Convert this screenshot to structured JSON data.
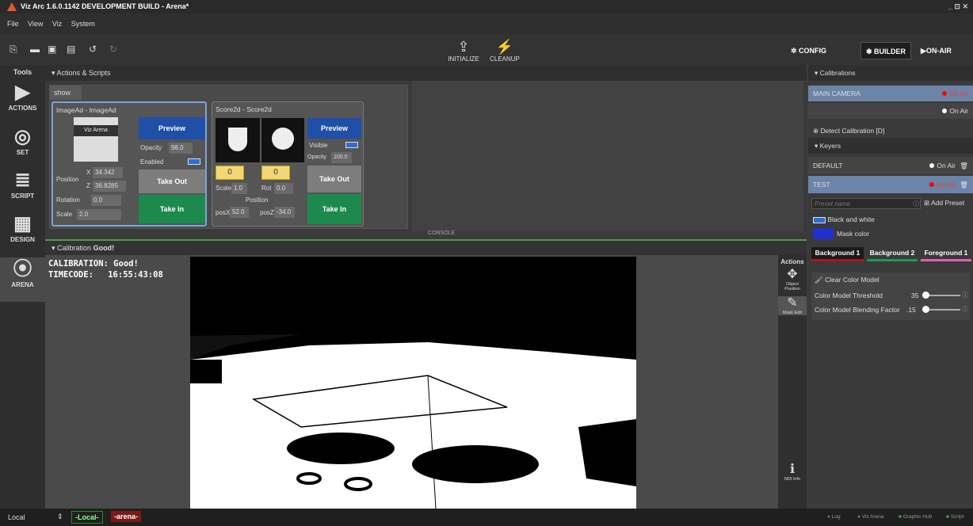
{
  "app": {
    "title": "Viz Arc 1.6.0.1142 DEVELOPMENT BUILD - Arena*",
    "window_controls": "_ ⊡ ✕"
  },
  "menu": [
    "File",
    "View",
    "Viz",
    "System"
  ],
  "toolbar": {
    "initialize": "INITIALIZE",
    "cleanup": "CLEANUP",
    "config": "CONFIG",
    "builder": "BUILDER",
    "on_air": "ON-AIR"
  },
  "tools": {
    "header": "Tools",
    "items": [
      "ACTIONS",
      "SET",
      "SCRIPT",
      "DESIGN",
      "ARENA"
    ]
  },
  "actions_panel": {
    "title": "Actions & Scripts",
    "tab": "show",
    "console": "CONSOLE"
  },
  "imagead": {
    "title": "ImageAd - ImageAd",
    "thumb_text": "Viz Arena",
    "preview": "Preview",
    "opacity_label": "Opacity",
    "opacity": "98.0",
    "enabled_label": "Enabled",
    "position_label": "Position",
    "x_label": "X",
    "x": "34.342",
    "z_label": "Z",
    "z": "36.8285",
    "rotation_label": "Rotation",
    "rotation": "0.0",
    "scale_label": "Scale",
    "scale": "2.0",
    "take_out": "Take Out",
    "take_in": "Take In"
  },
  "score2d": {
    "title": "Score2d - Score2d",
    "preview": "Preview",
    "visible_label": "Visible",
    "opacity_label": "Opacity",
    "opacity": "100.0",
    "score_home": "0",
    "score_away": "0",
    "scale_label": "Scale",
    "scale": "1.0",
    "rot_label": "Rot",
    "rot": "0.0",
    "position_label": "Position",
    "posx_label": "posX",
    "posx": "52.0",
    "posz_label": "posZ",
    "posz": "-34.0",
    "take_out": "Take Out",
    "take_in": "Take In"
  },
  "calibration_bar": {
    "label": "Calibration",
    "status": "Good!"
  },
  "overlay": {
    "calibration": "CALIBRATION: Good!",
    "timecode_label": "TIMECODE:",
    "timecode": "16:55:43:08"
  },
  "viewport_actions": {
    "header": "Actions",
    "object_position": "Object Position",
    "mask_edit": "Mask Edit",
    "ndi_info": "NDI Info"
  },
  "right_panel": {
    "calibrations_header": "Calibrations",
    "cameras": [
      {
        "name": "MAIN CAMERA",
        "status": "On Air"
      },
      {
        "name": "",
        "status": "On Air"
      }
    ],
    "detect": "Detect Calibration [D]",
    "keyers_header": "Keyers",
    "keyers": [
      {
        "name": "DEFAULT",
        "status": "On Air"
      },
      {
        "name": "TEST",
        "status": "On Air"
      }
    ],
    "preset_placeholder": "Preset name",
    "add_preset": "Add Preset",
    "black_and_white": "Black and white",
    "mask_color": "Mask color",
    "tabs": [
      "Background 1",
      "Background 2",
      "Foreground 1"
    ],
    "clear_model": "Clear Color Model",
    "threshold_label": "Color Model Threshold",
    "threshold": "35",
    "blending_label": "Color Model Blending Factor",
    "blending": ".15"
  },
  "statusbar": {
    "mode": "Local",
    "local_tag": "-Local-",
    "arena_tag": "-arena-",
    "items": [
      "Log",
      "Viz Arena",
      "Graphic Hub",
      "Script"
    ]
  },
  "colors": {
    "accent_blue": "#1f4fa8",
    "take_in_green": "#1c8a4d",
    "on_air_red": "#ff0000",
    "selected_row": "#6b84a8"
  }
}
